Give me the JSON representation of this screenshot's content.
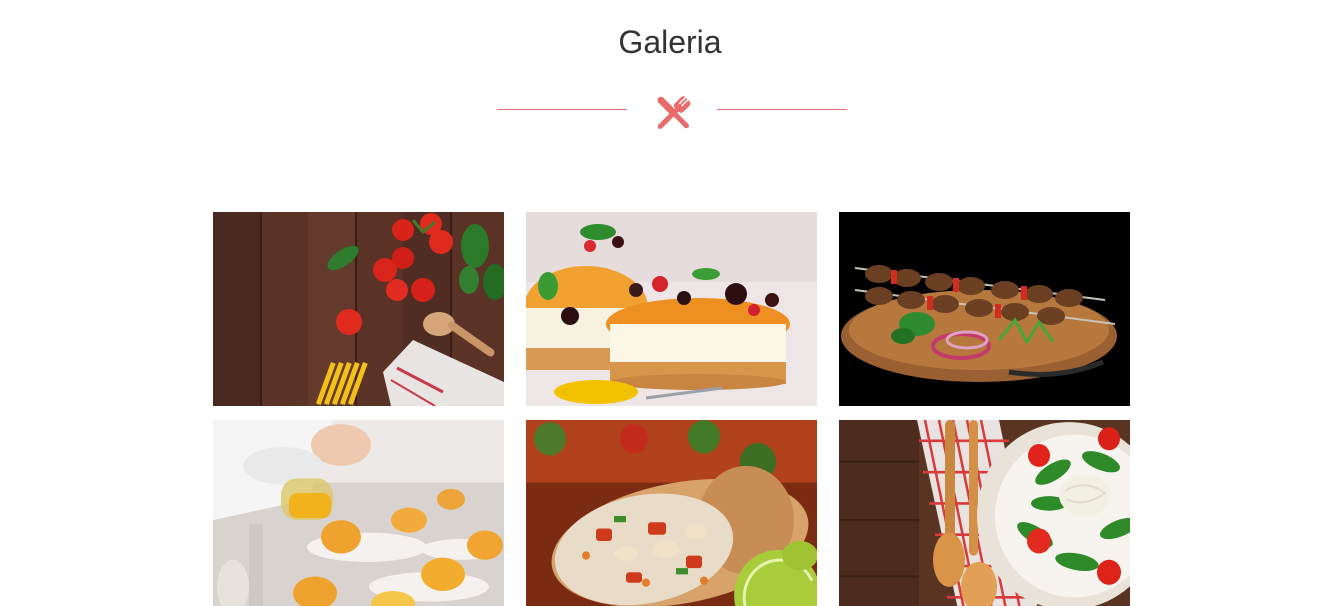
{
  "section": {
    "title": "Galeria",
    "divider_icon": "fork-knife-icon",
    "accent_color": "#e96b6b"
  },
  "gallery": {
    "items": [
      {
        "name": "tomatoes-pasta-photo"
      },
      {
        "name": "cheesecake-photo"
      },
      {
        "name": "skewers-photo"
      },
      {
        "name": "chef-plating-photo"
      },
      {
        "name": "burrito-photo"
      },
      {
        "name": "salad-photo"
      }
    ]
  }
}
